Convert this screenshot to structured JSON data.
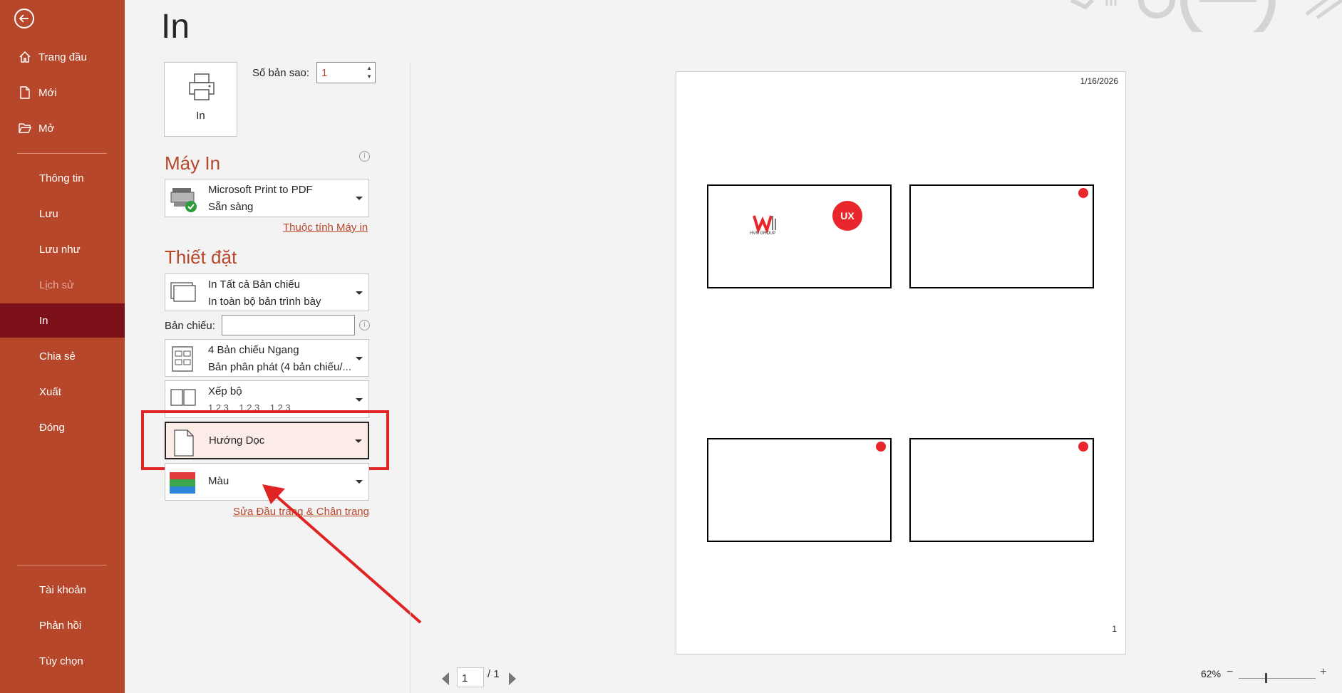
{
  "sidebar": {
    "items": [
      {
        "label": "Trang đầu",
        "icon": "home-icon"
      },
      {
        "label": "Mới",
        "icon": "new-document-icon"
      },
      {
        "label": "Mở",
        "icon": "folder-open-icon"
      },
      {
        "label": "Thông tin"
      },
      {
        "label": "Lưu"
      },
      {
        "label": "Lưu như"
      },
      {
        "label": "Lịch sử"
      },
      {
        "label": "In"
      },
      {
        "label": "Chia sẻ"
      },
      {
        "label": "Xuất"
      },
      {
        "label": "Đóng"
      },
      {
        "label": "Tài khoản"
      },
      {
        "label": "Phản hồi"
      },
      {
        "label": "Tùy chọn"
      }
    ]
  },
  "page": {
    "title": "In"
  },
  "print": {
    "button_label": "In",
    "copies_label": "Số bản sao:",
    "copies_value": "1"
  },
  "printer": {
    "section_title": "Máy In",
    "name": "Microsoft Print to PDF",
    "status": "Sẵn sàng",
    "properties_link": "Thuộc tính Máy in"
  },
  "settings": {
    "section_title": "Thiết đặt",
    "range": {
      "title": "In Tất cả Bản chiếu",
      "subtitle": "In toàn bộ bản trình bày"
    },
    "slides_label": "Bản chiếu:",
    "slides_value": "",
    "layout": {
      "title": "4 Bản chiếu Ngang",
      "subtitle": "Bản phân phát (4 bản chiếu/..."
    },
    "collate": {
      "title": "Xếp bộ",
      "subtitle": "1,2,3    1,2,3    1,2,3"
    },
    "orientation": {
      "title": "Hướng Dọc"
    },
    "color": {
      "title": "Màu"
    },
    "header_footer_link": "Sửa Đầu trang & Chân trang"
  },
  "preview": {
    "date": "1/16/2026",
    "page_number": "1",
    "logo_text_1": "HVN GROUP",
    "logo_text_2": "UX"
  },
  "pager": {
    "current": "1",
    "total": "/ 1"
  },
  "zoom": {
    "level": "62%",
    "minus": "−",
    "plus": "+"
  },
  "colors": {
    "accent": "#b7472a",
    "active": "#7b1018",
    "highlight": "#e02424"
  }
}
